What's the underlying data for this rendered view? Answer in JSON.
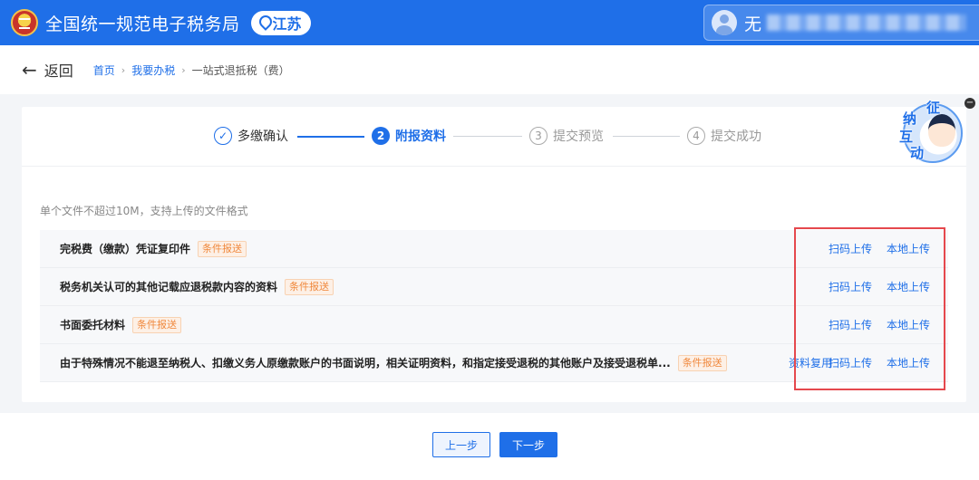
{
  "header": {
    "site_title": "全国统一规范电子税务局",
    "region": "江苏",
    "user_name": "无"
  },
  "nav": {
    "back_label": "返回",
    "breadcrumb": [
      "首页",
      "我要办税",
      "一站式退抵税（费）"
    ]
  },
  "steps": [
    {
      "index": "✓",
      "label": "多缴确认",
      "state": "done"
    },
    {
      "index": "2",
      "label": "附报资料",
      "state": "active"
    },
    {
      "index": "3",
      "label": "提交预览",
      "state": "todo"
    },
    {
      "index": "4",
      "label": "提交成功",
      "state": "todo"
    }
  ],
  "hint": "单个文件不超过10M，支持上传的文件格式",
  "files": [
    {
      "name": "完税费（缴款）凭证复印件",
      "tag": "条件报送",
      "actions": [
        "扫码上传",
        "本地上传"
      ]
    },
    {
      "name": "税务机关认可的其他记载应退税款内容的资料",
      "tag": "条件报送",
      "actions": [
        "扫码上传",
        "本地上传"
      ]
    },
    {
      "name": "书面委托材料",
      "tag": "条件报送",
      "actions": [
        "扫码上传",
        "本地上传"
      ]
    },
    {
      "name": "由于特殊情况不能退至纳税人、扣缴义务人原缴款账户的书面说明，相关证明资料，和指定接受退税的其他账户及接受退税单...",
      "tag": "条件报送",
      "reuse": "资料复用",
      "actions": [
        "扫码上传",
        "本地上传"
      ]
    }
  ],
  "helper": {
    "chars": [
      "征",
      "纳",
      "互",
      "动"
    ]
  },
  "footer": {
    "prev_label": "上一步",
    "next_label": "下一步"
  },
  "colors": {
    "primary": "#1f6fe8",
    "highlight": "#e5484d",
    "tag": "#f0883c"
  }
}
